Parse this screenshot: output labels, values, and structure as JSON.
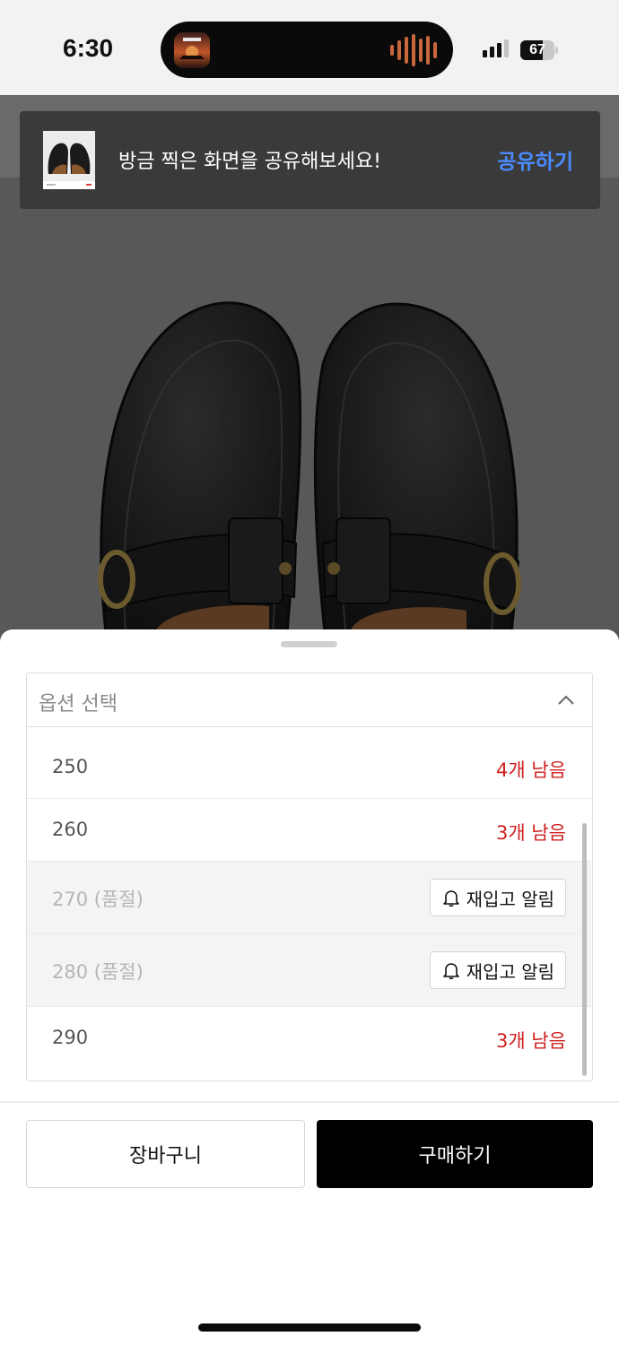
{
  "status_bar": {
    "time": "6:30",
    "battery_level": "67",
    "battery_fraction": 0.67,
    "signal_bars": 4,
    "signal_active": 3
  },
  "toast": {
    "message": "방금 찍은 화면을 공유해보세요!",
    "share_label": "공유하기",
    "accent": "#4a8cff"
  },
  "option_select": {
    "placeholder": "옵션 선택",
    "expanded": true,
    "options": [
      {
        "label": "250",
        "stock": "4개 남음",
        "soldout": false
      },
      {
        "label": "260",
        "stock": "3개 남음",
        "soldout": false
      },
      {
        "label": "270 (품절)",
        "restock_label": "재입고 알림",
        "soldout": true
      },
      {
        "label": "280 (품절)",
        "restock_label": "재입고 알림",
        "soldout": true
      },
      {
        "label": "290",
        "stock": "3개 남음",
        "soldout": false
      }
    ]
  },
  "actions": {
    "cart_label": "장바구니",
    "buy_label": "구매하기"
  },
  "colors": {
    "stock_red": "#d01f1f",
    "buy_button": "#000000"
  }
}
